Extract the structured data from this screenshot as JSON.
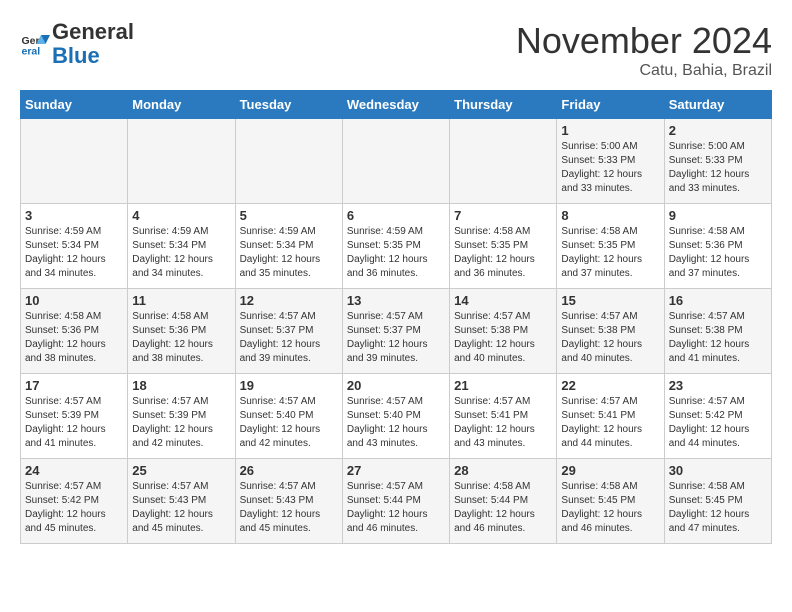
{
  "logo": {
    "line1": "General",
    "line2": "Blue"
  },
  "title": "November 2024",
  "location": "Catu, Bahia, Brazil",
  "headers": [
    "Sunday",
    "Monday",
    "Tuesday",
    "Wednesday",
    "Thursday",
    "Friday",
    "Saturday"
  ],
  "weeks": [
    [
      {
        "day": "",
        "info": ""
      },
      {
        "day": "",
        "info": ""
      },
      {
        "day": "",
        "info": ""
      },
      {
        "day": "",
        "info": ""
      },
      {
        "day": "",
        "info": ""
      },
      {
        "day": "1",
        "info": "Sunrise: 5:00 AM\nSunset: 5:33 PM\nDaylight: 12 hours\nand 33 minutes."
      },
      {
        "day": "2",
        "info": "Sunrise: 5:00 AM\nSunset: 5:33 PM\nDaylight: 12 hours\nand 33 minutes."
      }
    ],
    [
      {
        "day": "3",
        "info": "Sunrise: 4:59 AM\nSunset: 5:34 PM\nDaylight: 12 hours\nand 34 minutes."
      },
      {
        "day": "4",
        "info": "Sunrise: 4:59 AM\nSunset: 5:34 PM\nDaylight: 12 hours\nand 34 minutes."
      },
      {
        "day": "5",
        "info": "Sunrise: 4:59 AM\nSunset: 5:34 PM\nDaylight: 12 hours\nand 35 minutes."
      },
      {
        "day": "6",
        "info": "Sunrise: 4:59 AM\nSunset: 5:35 PM\nDaylight: 12 hours\nand 36 minutes."
      },
      {
        "day": "7",
        "info": "Sunrise: 4:58 AM\nSunset: 5:35 PM\nDaylight: 12 hours\nand 36 minutes."
      },
      {
        "day": "8",
        "info": "Sunrise: 4:58 AM\nSunset: 5:35 PM\nDaylight: 12 hours\nand 37 minutes."
      },
      {
        "day": "9",
        "info": "Sunrise: 4:58 AM\nSunset: 5:36 PM\nDaylight: 12 hours\nand 37 minutes."
      }
    ],
    [
      {
        "day": "10",
        "info": "Sunrise: 4:58 AM\nSunset: 5:36 PM\nDaylight: 12 hours\nand 38 minutes."
      },
      {
        "day": "11",
        "info": "Sunrise: 4:58 AM\nSunset: 5:36 PM\nDaylight: 12 hours\nand 38 minutes."
      },
      {
        "day": "12",
        "info": "Sunrise: 4:57 AM\nSunset: 5:37 PM\nDaylight: 12 hours\nand 39 minutes."
      },
      {
        "day": "13",
        "info": "Sunrise: 4:57 AM\nSunset: 5:37 PM\nDaylight: 12 hours\nand 39 minutes."
      },
      {
        "day": "14",
        "info": "Sunrise: 4:57 AM\nSunset: 5:38 PM\nDaylight: 12 hours\nand 40 minutes."
      },
      {
        "day": "15",
        "info": "Sunrise: 4:57 AM\nSunset: 5:38 PM\nDaylight: 12 hours\nand 40 minutes."
      },
      {
        "day": "16",
        "info": "Sunrise: 4:57 AM\nSunset: 5:38 PM\nDaylight: 12 hours\nand 41 minutes."
      }
    ],
    [
      {
        "day": "17",
        "info": "Sunrise: 4:57 AM\nSunset: 5:39 PM\nDaylight: 12 hours\nand 41 minutes."
      },
      {
        "day": "18",
        "info": "Sunrise: 4:57 AM\nSunset: 5:39 PM\nDaylight: 12 hours\nand 42 minutes."
      },
      {
        "day": "19",
        "info": "Sunrise: 4:57 AM\nSunset: 5:40 PM\nDaylight: 12 hours\nand 42 minutes."
      },
      {
        "day": "20",
        "info": "Sunrise: 4:57 AM\nSunset: 5:40 PM\nDaylight: 12 hours\nand 43 minutes."
      },
      {
        "day": "21",
        "info": "Sunrise: 4:57 AM\nSunset: 5:41 PM\nDaylight: 12 hours\nand 43 minutes."
      },
      {
        "day": "22",
        "info": "Sunrise: 4:57 AM\nSunset: 5:41 PM\nDaylight: 12 hours\nand 44 minutes."
      },
      {
        "day": "23",
        "info": "Sunrise: 4:57 AM\nSunset: 5:42 PM\nDaylight: 12 hours\nand 44 minutes."
      }
    ],
    [
      {
        "day": "24",
        "info": "Sunrise: 4:57 AM\nSunset: 5:42 PM\nDaylight: 12 hours\nand 45 minutes."
      },
      {
        "day": "25",
        "info": "Sunrise: 4:57 AM\nSunset: 5:43 PM\nDaylight: 12 hours\nand 45 minutes."
      },
      {
        "day": "26",
        "info": "Sunrise: 4:57 AM\nSunset: 5:43 PM\nDaylight: 12 hours\nand 45 minutes."
      },
      {
        "day": "27",
        "info": "Sunrise: 4:57 AM\nSunset: 5:44 PM\nDaylight: 12 hours\nand 46 minutes."
      },
      {
        "day": "28",
        "info": "Sunrise: 4:58 AM\nSunset: 5:44 PM\nDaylight: 12 hours\nand 46 minutes."
      },
      {
        "day": "29",
        "info": "Sunrise: 4:58 AM\nSunset: 5:45 PM\nDaylight: 12 hours\nand 46 minutes."
      },
      {
        "day": "30",
        "info": "Sunrise: 4:58 AM\nSunset: 5:45 PM\nDaylight: 12 hours\nand 47 minutes."
      }
    ]
  ]
}
